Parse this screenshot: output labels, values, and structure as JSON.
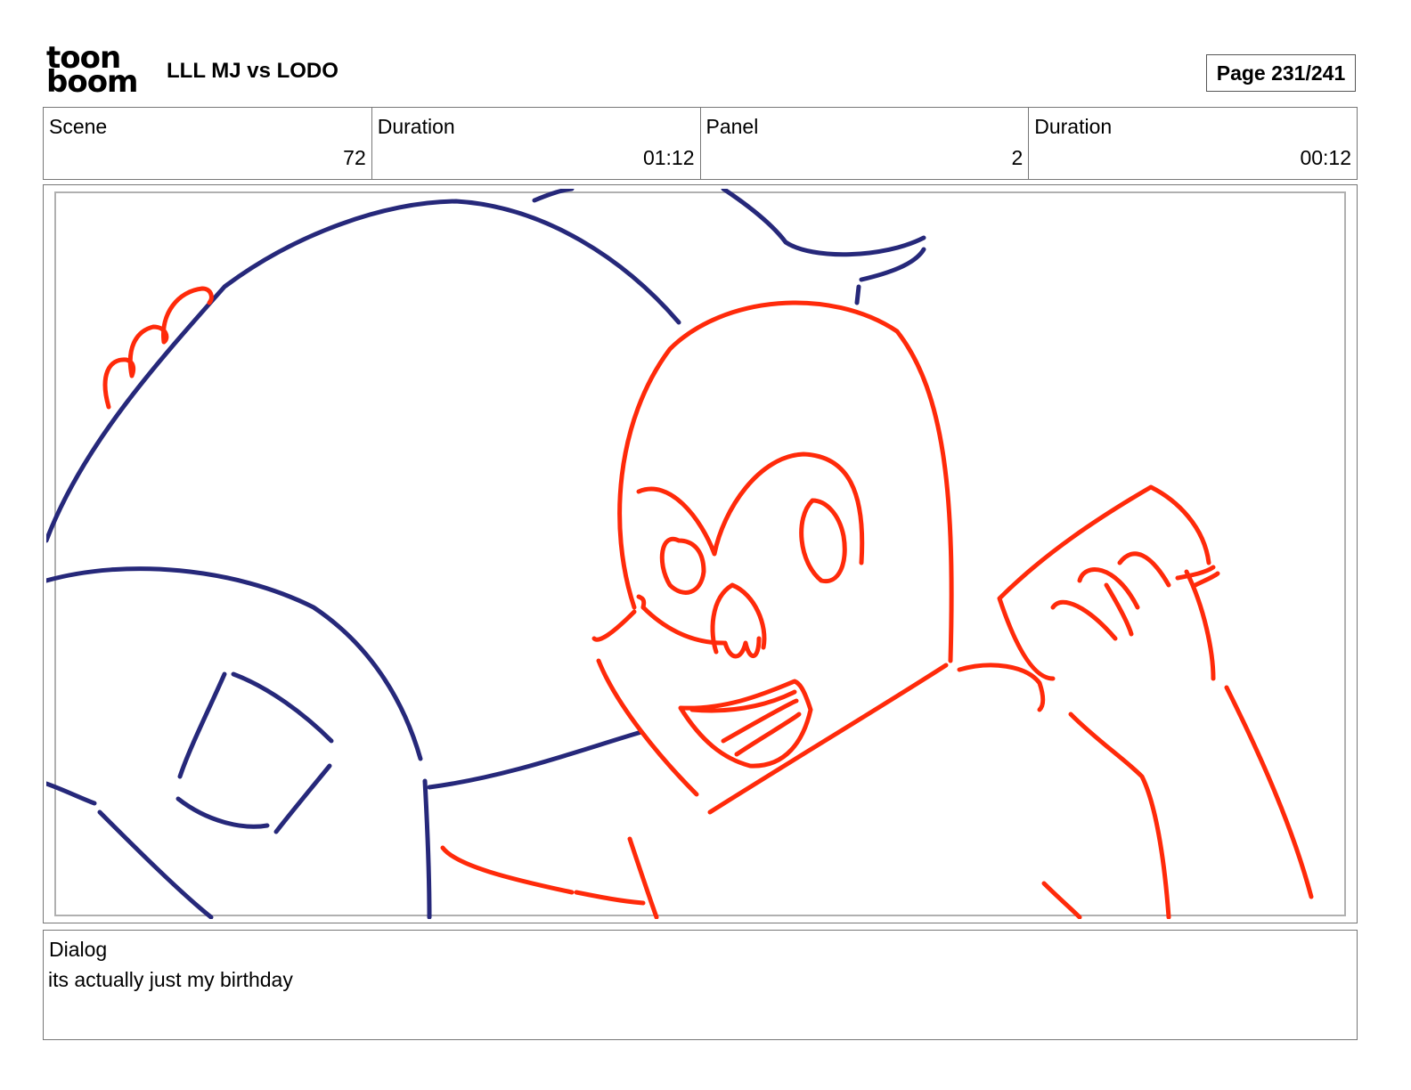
{
  "header": {
    "logo_line1": "toon",
    "logo_line2": "boom",
    "project_title": "LLL MJ vs LODO",
    "page_indicator": "Page 231/241"
  },
  "info": {
    "scene_label": "Scene",
    "scene_value": "72",
    "scene_duration_label": "Duration",
    "scene_duration_value": "01:12",
    "panel_label": "Panel",
    "panel_value": "2",
    "panel_duration_label": "Duration",
    "panel_duration_value": "00:12"
  },
  "panel": {
    "ink_colors": {
      "character_left": "#26287a",
      "character_right": "#ff2a0a"
    }
  },
  "dialog": {
    "label": "Dialog",
    "text": "its actually just my birthday"
  }
}
